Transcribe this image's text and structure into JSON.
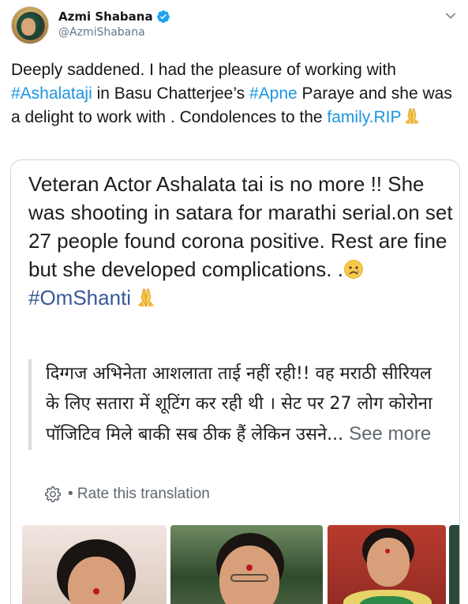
{
  "author": {
    "name": "Azmi Shabana",
    "handle": "@AzmiShabana"
  },
  "tweet": {
    "t1": "Deeply saddened. I had the pleasure of working with ",
    "link1": "#Ashalataji",
    "t2": " in Basu Chatterjee’s ",
    "link2": "#Apne",
    "t3": " Paraye and she was a delight to work with . Condolences to the ",
    "link3": "family.RIP"
  },
  "quoted": {
    "text": "Veteran Actor Ashalata tai is no more !! She was shooting in satara for marathi serial.on set 27 people found corona positive. Rest are fine but she developed complications. .",
    "hashtag": "#OmShanti",
    "translation": "दिग्गज अभिनेता आशलाता ताई नहीं रही!! वह मराठी सीरियल के लिए सतारा में शूटिंग कर रही थी । सेट पर 27 लोग कोरोना पॉजिटिव मिले बाकी सब ठीक हैं लेकिन उसने... ",
    "see_more": "See more",
    "rate_label": "• Rate this translation"
  },
  "icons": {
    "verified": "verified-badge-icon",
    "chevron": "chevron-down-icon",
    "pray": "folded-hands-emoji",
    "sad": "crying-face-emoji",
    "gear": "gear-icon"
  },
  "colors": {
    "link": "#1b95e0",
    "hashtag": "#385898",
    "muted": "#606770"
  }
}
